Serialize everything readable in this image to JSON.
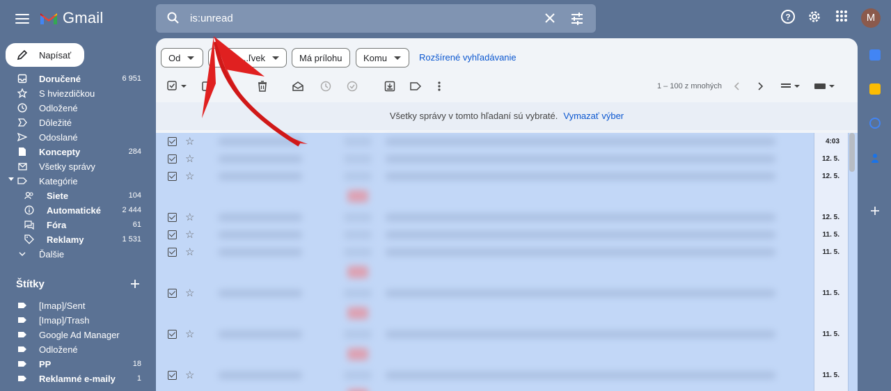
{
  "app": {
    "name": "Gmail",
    "avatar_letter": "M"
  },
  "search": {
    "query": "is:unread"
  },
  "compose": {
    "label": "Napísať"
  },
  "nav": [
    {
      "label": "Doručené",
      "count": "6 951",
      "bold": true,
      "icon": "inbox-icon"
    },
    {
      "label": "S hviezdičkou",
      "count": "",
      "bold": false,
      "icon": "star-icon"
    },
    {
      "label": "Odložené",
      "count": "",
      "bold": false,
      "icon": "clock-icon"
    },
    {
      "label": "Dôležité",
      "count": "",
      "bold": false,
      "icon": "important-icon"
    },
    {
      "label": "Odoslané",
      "count": "",
      "bold": false,
      "icon": "send-icon"
    },
    {
      "label": "Koncepty",
      "count": "284",
      "bold": true,
      "icon": "draft-icon"
    },
    {
      "label": "Všetky správy",
      "count": "",
      "bold": false,
      "icon": "all-mail-icon"
    },
    {
      "label": "Kategórie",
      "count": "",
      "bold": false,
      "icon": "label-outline-icon"
    }
  ],
  "categories": [
    {
      "label": "Siete",
      "count": "104",
      "icon": "people-icon"
    },
    {
      "label": "Automatické",
      "count": "2 444",
      "icon": "info-icon"
    },
    {
      "label": "Fóra",
      "count": "61",
      "icon": "forum-icon"
    },
    {
      "label": "Reklamy",
      "count": "1 531",
      "icon": "tag-icon"
    }
  ],
  "more": {
    "label": "Ďalšie"
  },
  "labels_section": {
    "title": "Štítky"
  },
  "labels": [
    {
      "label": "[Imap]/Sent",
      "count": "",
      "bold": false
    },
    {
      "label": "[Imap]/Trash",
      "count": "",
      "bold": false
    },
    {
      "label": "Google Ad Manager",
      "count": "",
      "bold": false
    },
    {
      "label": "Odložené",
      "count": "",
      "bold": false
    },
    {
      "label": "PP",
      "count": "18",
      "bold": true
    },
    {
      "label": "Reklamné e-maily",
      "count": "1",
      "bold": true
    }
  ],
  "filters": {
    "from": "Od",
    "subject_partial": "...ľvek",
    "has_attachment": "Má prílohu",
    "to": "Komu",
    "advanced": "Rozšírené vyhľadávanie"
  },
  "pager": {
    "text": "1 – 100 z mnohých"
  },
  "banner": {
    "text": "Všetky správy v tomto hľadaní sú vybraté.",
    "clear_link": "Vymazať výber"
  },
  "emails": [
    {
      "date": "4:03",
      "tall": false
    },
    {
      "date": "12. 5.",
      "tall": false
    },
    {
      "date": "12. 5.",
      "tall": true
    },
    {
      "date": "12. 5.",
      "tall": false
    },
    {
      "date": "11. 5.",
      "tall": false
    },
    {
      "date": "11. 5.",
      "tall": true
    },
    {
      "date": "11. 5.",
      "tall": true
    },
    {
      "date": "11. 5.",
      "tall": true
    },
    {
      "date": "11. 5.",
      "tall": true
    }
  ],
  "colors": {
    "background": "#5b7294",
    "selected_row": "#c2d7f7",
    "link": "#0b57d0",
    "annotation_arrow": "#e02020"
  }
}
